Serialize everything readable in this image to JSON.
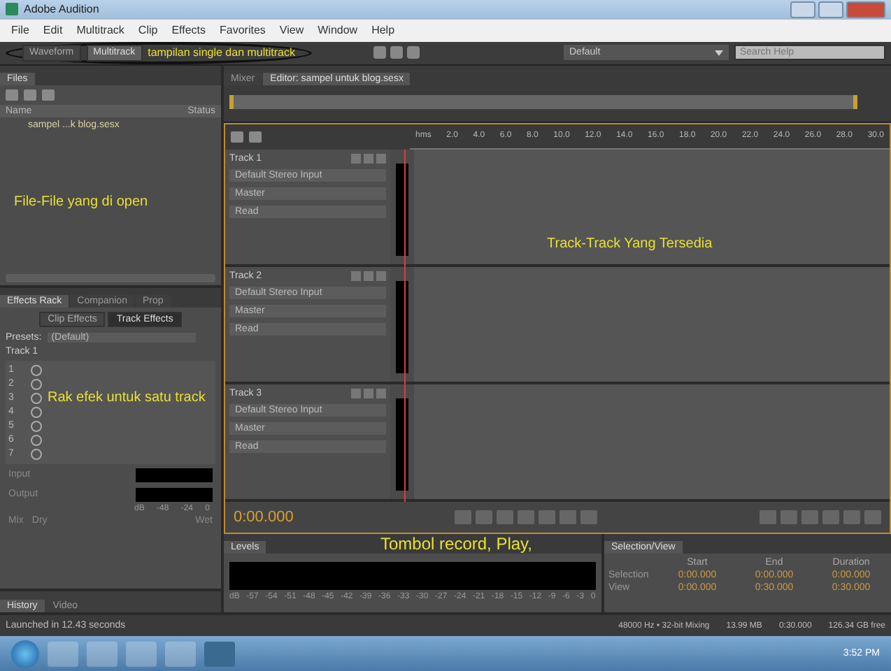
{
  "window": {
    "title": "Adobe Audition"
  },
  "menu": [
    "File",
    "Edit",
    "Multitrack",
    "Clip",
    "Effects",
    "Favorites",
    "View",
    "Window",
    "Help"
  ],
  "toolbar": {
    "views": [
      {
        "label": "Waveform",
        "selected": false
      },
      {
        "label": "Multitrack",
        "selected": true
      }
    ],
    "workspace": "Default",
    "search": {
      "placeholder": "Search Help"
    }
  },
  "annotations": {
    "views": "tampilan single dan multitrack",
    "files": "File-File yang di open",
    "effects": "Rak efek untuk satu track",
    "tracks": "Track-Track Yang Tersedia",
    "transport": "Tombol record, Play,"
  },
  "files_panel": {
    "tab": "Files",
    "columns": [
      "Name",
      "Status"
    ],
    "items": [
      "sampel ...k blog.sesx"
    ]
  },
  "effects_panel": {
    "tabs": [
      {
        "label": "Effects Rack",
        "selected": true
      },
      {
        "label": "Companion",
        "selected": false
      },
      {
        "label": "Prop",
        "selected": false
      }
    ],
    "modes": [
      {
        "label": "Clip Effects",
        "selected": false
      },
      {
        "label": "Track Effects",
        "selected": true
      }
    ],
    "presets_label": "Presets:",
    "preset": "(Default)",
    "track": "Track 1",
    "slots": [
      "1",
      "2",
      "3",
      "4",
      "5",
      "6",
      "7"
    ],
    "meters": [
      "Input",
      "Output"
    ],
    "scale": [
      "dB",
      "-48",
      "-24",
      "0"
    ],
    "mix": "Mix",
    "footer": [
      "Dry",
      "Wet"
    ]
  },
  "history_panel": {
    "tabs": [
      "History",
      "Video"
    ]
  },
  "editor": {
    "tabs": [
      {
        "label": "Mixer",
        "selected": false
      },
      {
        "label": "Editor: sampel untuk blog.sesx",
        "selected": true
      }
    ],
    "ruler": [
      "hms",
      "2.0",
      "4.0",
      "6.0",
      "8.0",
      "10.0",
      "12.0",
      "14.0",
      "16.0",
      "18.0",
      "20.0",
      "22.0",
      "24.0",
      "26.0",
      "28.0",
      "30.0"
    ],
    "tracks": [
      {
        "name": "Track 1",
        "input": "Default Stereo Input",
        "output": "Master",
        "automation": "Read"
      },
      {
        "name": "Track 2",
        "input": "Default Stereo Input",
        "output": "Master",
        "automation": "Read"
      },
      {
        "name": "Track 3",
        "input": "Default Stereo Input",
        "output": "Master",
        "automation": "Read"
      }
    ],
    "time": "0:00.000"
  },
  "levels_panel": {
    "tab": "Levels",
    "scale": [
      "dB",
      "-57",
      "-54",
      "-51",
      "-48",
      "-45",
      "-42",
      "-39",
      "-36",
      "-33",
      "-30",
      "-27",
      "-24",
      "-21",
      "-18",
      "-15",
      "-12",
      "-9",
      "-6",
      "-3",
      "0"
    ]
  },
  "selection_panel": {
    "tab": "Selection/View",
    "columns": [
      "Start",
      "End",
      "Duration"
    ],
    "rows": [
      {
        "label": "Selection",
        "values": [
          "0:00.000",
          "0:00.000",
          "0:00.000"
        ]
      },
      {
        "label": "View",
        "values": [
          "0:00.000",
          "0:30.000",
          "0:30.000"
        ]
      }
    ]
  },
  "status_bar": {
    "message": "Launched in 12.43 seconds",
    "items": [
      "48000 Hz • 32-bit Mixing",
      "13.99 MB",
      "0:30.000",
      "126.34 GB free"
    ]
  },
  "taskbar": {
    "clock": "3:52 PM"
  }
}
